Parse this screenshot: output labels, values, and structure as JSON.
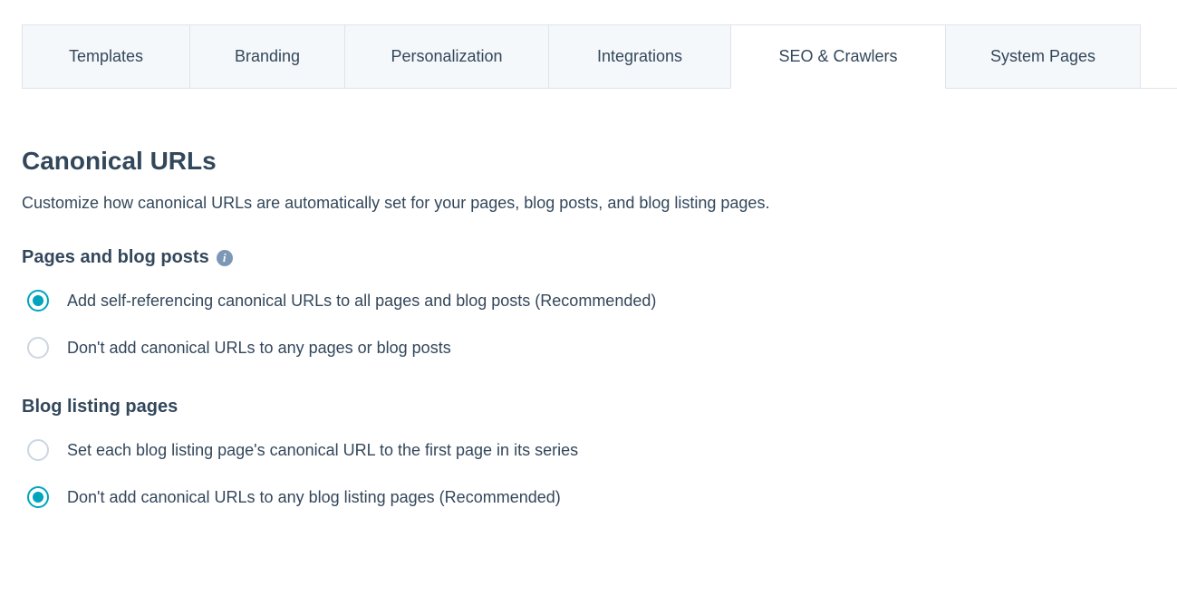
{
  "tabs": {
    "templates": "Templates",
    "branding": "Branding",
    "personalization": "Personalization",
    "integrations": "Integrations",
    "seo": "SEO & Crawlers",
    "system_pages": "System Pages",
    "active": "seo"
  },
  "section": {
    "title": "Canonical URLs",
    "description": "Customize how canonical URLs are automatically set for your pages, blog posts, and blog listing pages."
  },
  "pages_blog_posts": {
    "title": "Pages and blog posts",
    "info_icon": "info",
    "options": [
      {
        "label": "Add self-referencing canonical URLs to all pages and blog posts (Recommended)",
        "selected": true
      },
      {
        "label": "Don't add canonical URLs to any pages or blog posts",
        "selected": false
      }
    ]
  },
  "blog_listing_pages": {
    "title": "Blog listing pages",
    "options": [
      {
        "label": "Set each blog listing page's canonical URL to the first page in its series",
        "selected": false
      },
      {
        "label": "Don't add canonical URLs to any blog listing pages (Recommended)",
        "selected": true
      }
    ]
  }
}
